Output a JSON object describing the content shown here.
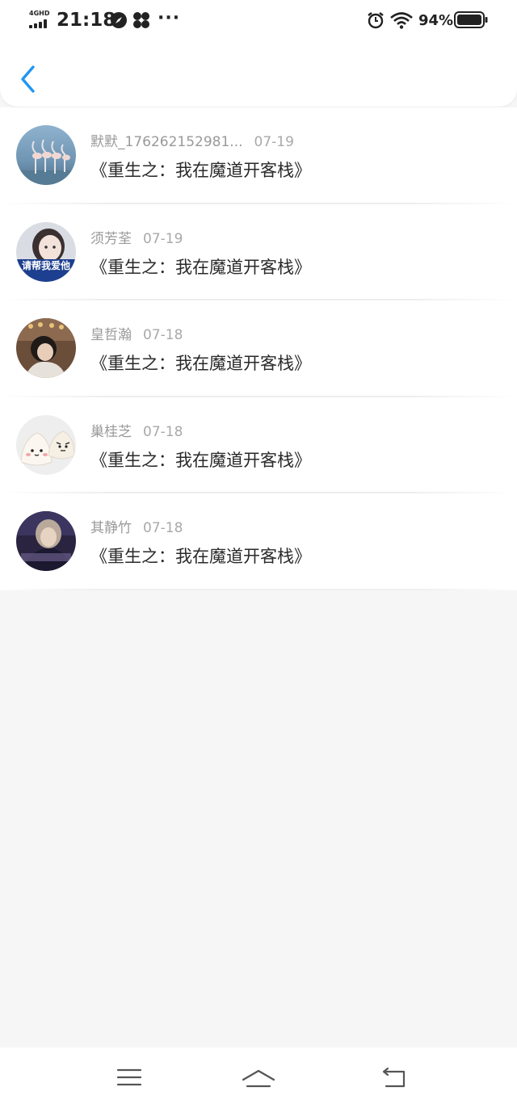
{
  "status_bar": {
    "network": "4GHD",
    "time": "21:18",
    "more": "···",
    "battery": "94%"
  },
  "header": {
    "back_icon": "chevron-left-icon",
    "accent": "#2196f3"
  },
  "items": [
    {
      "name": "默默_176262152981...",
      "date": "07-19",
      "text": "《重生之：我在魔道开客栈》"
    },
    {
      "name": "须芳荃",
      "date": "07-19",
      "text": "《重生之：我在魔道开客栈》"
    },
    {
      "name": "皇哲瀚",
      "date": "07-18",
      "text": "《重生之：我在魔道开客栈》"
    },
    {
      "name": "巢桂芝",
      "date": "07-18",
      "text": "《重生之：我在魔道开客栈》"
    },
    {
      "name": "其静竹",
      "date": "07-18",
      "text": "《重生之：我在魔道开客栈》"
    }
  ],
  "avatar_2_caption": "请帮我爱他",
  "nav": {
    "menu_icon": "menu-icon",
    "home_icon": "home-icon",
    "back_icon": "return-icon"
  }
}
